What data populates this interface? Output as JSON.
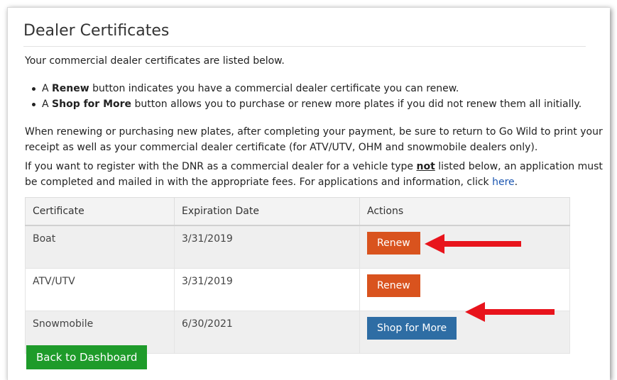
{
  "page": {
    "title": "Dealer Certificates",
    "intro": "Your commercial dealer certificates are listed below.",
    "bullets": [
      {
        "prefix": "A ",
        "strong": "Renew",
        "suffix": " button indicates you have a commercial dealer certificate you can renew."
      },
      {
        "prefix": "A ",
        "strong": "Shop for More",
        "suffix": " button allows you to purchase or renew more plates if you did not renew them all initially."
      }
    ],
    "paragraph1": "When renewing or purchasing new plates, after completing your payment, be sure to return to Go Wild to print your receipt as well as your commercial dealer certificate (for ATV/UTV, OHM and snowmobile dealers only).",
    "paragraph2": {
      "before": "If you want to register with the DNR as a commercial dealer for a vehicle type ",
      "emphasis": "not",
      "after": " listed below, an application must be completed and mailed in with the appropriate fees. For applications and information, click ",
      "link": "here",
      "end": "."
    }
  },
  "table": {
    "headers": [
      "Certificate",
      "Expiration Date",
      "Actions"
    ],
    "rows": [
      {
        "certificate": "Boat",
        "expiration": "3/31/2019",
        "action": "Renew"
      },
      {
        "certificate": "ATV/UTV",
        "expiration": "3/31/2019",
        "action": "Renew"
      },
      {
        "certificate": "Snowmobile",
        "expiration": "6/30/2021",
        "action": "Shop for More"
      }
    ]
  },
  "footer": {
    "back_label": "Back to Dashboard"
  },
  "colors": {
    "renew": "#d9531e",
    "shop": "#2e6da4",
    "back": "#1e9b2a",
    "arrow": "#e8141c"
  },
  "icons": [
    "left-arrow-icon",
    "left-arrow-icon"
  ]
}
